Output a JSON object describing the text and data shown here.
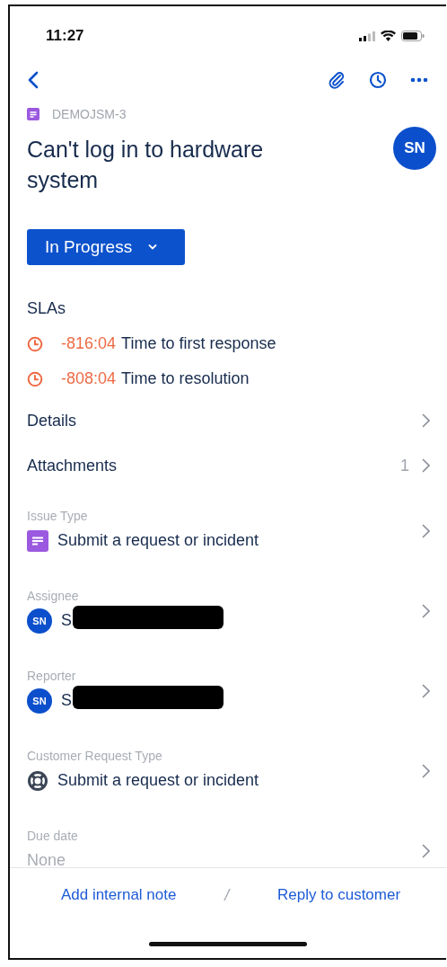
{
  "status_bar": {
    "time": "11:27"
  },
  "issue": {
    "key": "DEMOJSM-3",
    "title": "Can't log in to hardware system",
    "avatar": "SN"
  },
  "status_button": {
    "label": "In Progress"
  },
  "slas": {
    "heading": "SLAs",
    "items": [
      {
        "time": "-816:04",
        "label": "Time to first response"
      },
      {
        "time": "-808:04",
        "label": "Time to resolution"
      }
    ]
  },
  "sections": [
    {
      "label": "Details"
    },
    {
      "label": "Attachments",
      "count": "1"
    }
  ],
  "fields": [
    {
      "kind": "issue-type",
      "label": "Issue Type",
      "value": "Submit a request or incident"
    },
    {
      "kind": "person",
      "label": "Assignee",
      "avatar": "SN",
      "value": "S"
    },
    {
      "kind": "person",
      "label": "Reporter",
      "avatar": "SN",
      "value": "S"
    },
    {
      "kind": "request-type",
      "label": "Customer Request Type",
      "value": "Submit a request or incident"
    },
    {
      "kind": "text",
      "label": "Due date",
      "value": "None"
    }
  ],
  "actions": [
    "Add internal note",
    "/",
    "Reply to customer"
  ]
}
